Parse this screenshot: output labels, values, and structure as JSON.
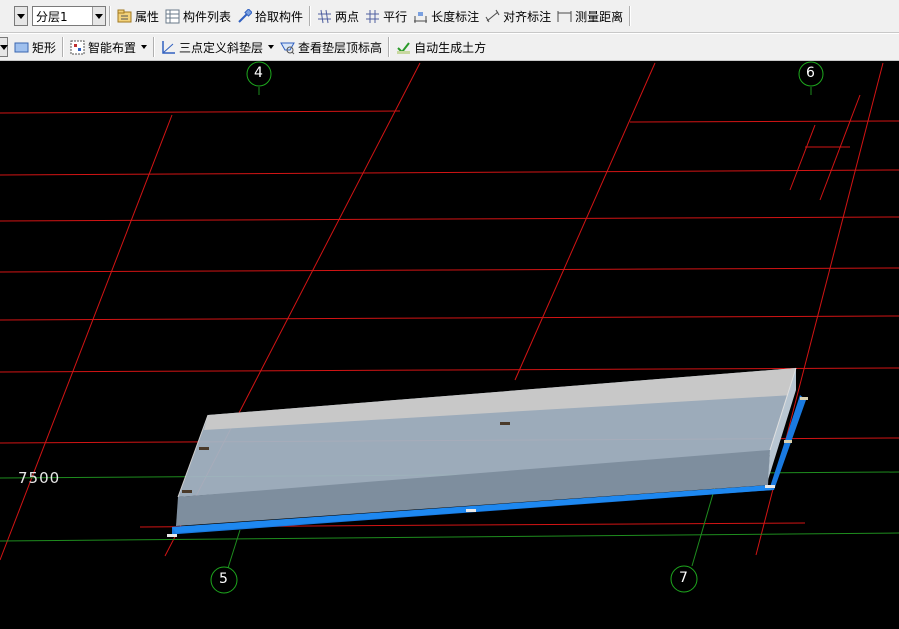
{
  "toolbar1": {
    "layer_value": "分层1",
    "properties": "属性",
    "component_list": "构件列表",
    "pick_component": "拾取构件",
    "two_points": "两点",
    "parallel": "平行",
    "length_dim": "长度标注",
    "aligned_dim": "对齐标注",
    "measure_distance": "测量距离"
  },
  "toolbar2": {
    "rectangle": "矩形",
    "smart_layout": "智能布置",
    "three_point_slope": "三点定义斜垫层",
    "view_top_elevation": "查看垫层顶标高",
    "auto_earthwork": "自动生成土方"
  },
  "viewport": {
    "axis_labels": [
      "4",
      "6",
      "5",
      "7"
    ],
    "dimension_label": "7500"
  },
  "colors": {
    "grid_red": "#d21414",
    "grid_green": "#1e8c1e",
    "slab_top": "#a4b4c4",
    "slab_front": "#7e8e9e",
    "slab_base": "#1a7ae0"
  }
}
